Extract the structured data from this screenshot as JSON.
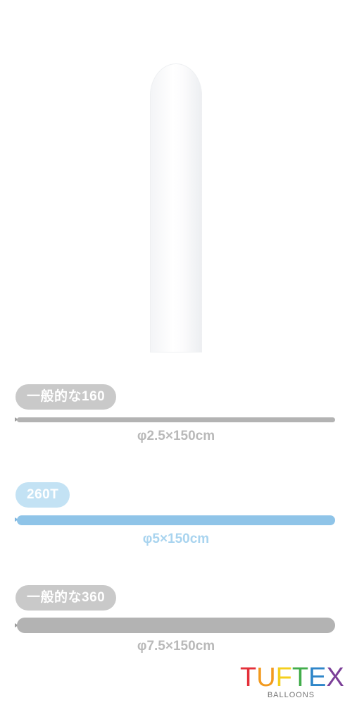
{
  "balloon": {
    "color": "#f7f8fa"
  },
  "sections": [
    {
      "label": "一般的な160",
      "size": "φ2.5×150cm"
    },
    {
      "label": "260T",
      "size": "φ5×150cm"
    },
    {
      "label": "一般的な360",
      "size": "φ7.5×150cm"
    }
  ],
  "logo": {
    "letters": [
      "T",
      "U",
      "F",
      "T",
      "E",
      "X"
    ],
    "letter_colors": [
      "#e4303a",
      "#f29a1f",
      "#f4cf1d",
      "#43ad4c",
      "#2f86c9",
      "#7b3f98"
    ],
    "subtitle": "BALLOONS"
  },
  "colors": {
    "gray": "#b3b3b3",
    "blue": "#8fc4e8"
  }
}
